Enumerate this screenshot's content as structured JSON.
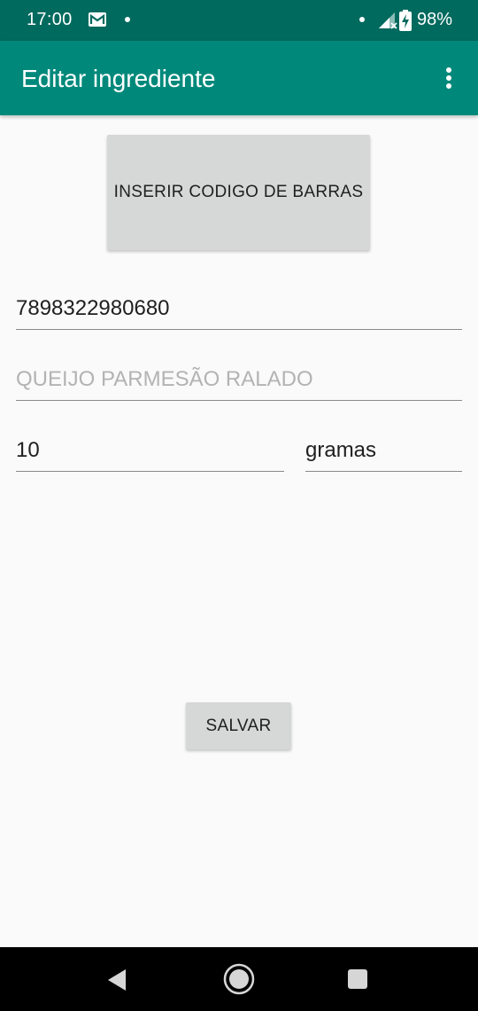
{
  "status_bar": {
    "time": "17:00",
    "battery_percent": "98%",
    "icons": [
      "gmail-icon",
      "notification-dot-icon",
      "signal-icon",
      "battery-charging-icon"
    ]
  },
  "app_bar": {
    "title": "Editar ingrediente",
    "menu_icon": "more-vert-icon"
  },
  "form": {
    "barcode_button_label": "INSERIR CODIGO DE BARRAS",
    "barcode_value": "7898322980680",
    "name_placeholder": "QUEIJO PARMESÃO RALADO",
    "quantity_value": "10",
    "unit_value": "gramas",
    "save_button_label": "SALVAR"
  },
  "nav_bar": {
    "icons": [
      "back-icon",
      "home-icon",
      "recent-apps-icon"
    ]
  },
  "colors": {
    "status_bar": "#006a5e",
    "app_bar": "#00897b",
    "button": "#d6d7d7",
    "background": "#fafafa"
  }
}
